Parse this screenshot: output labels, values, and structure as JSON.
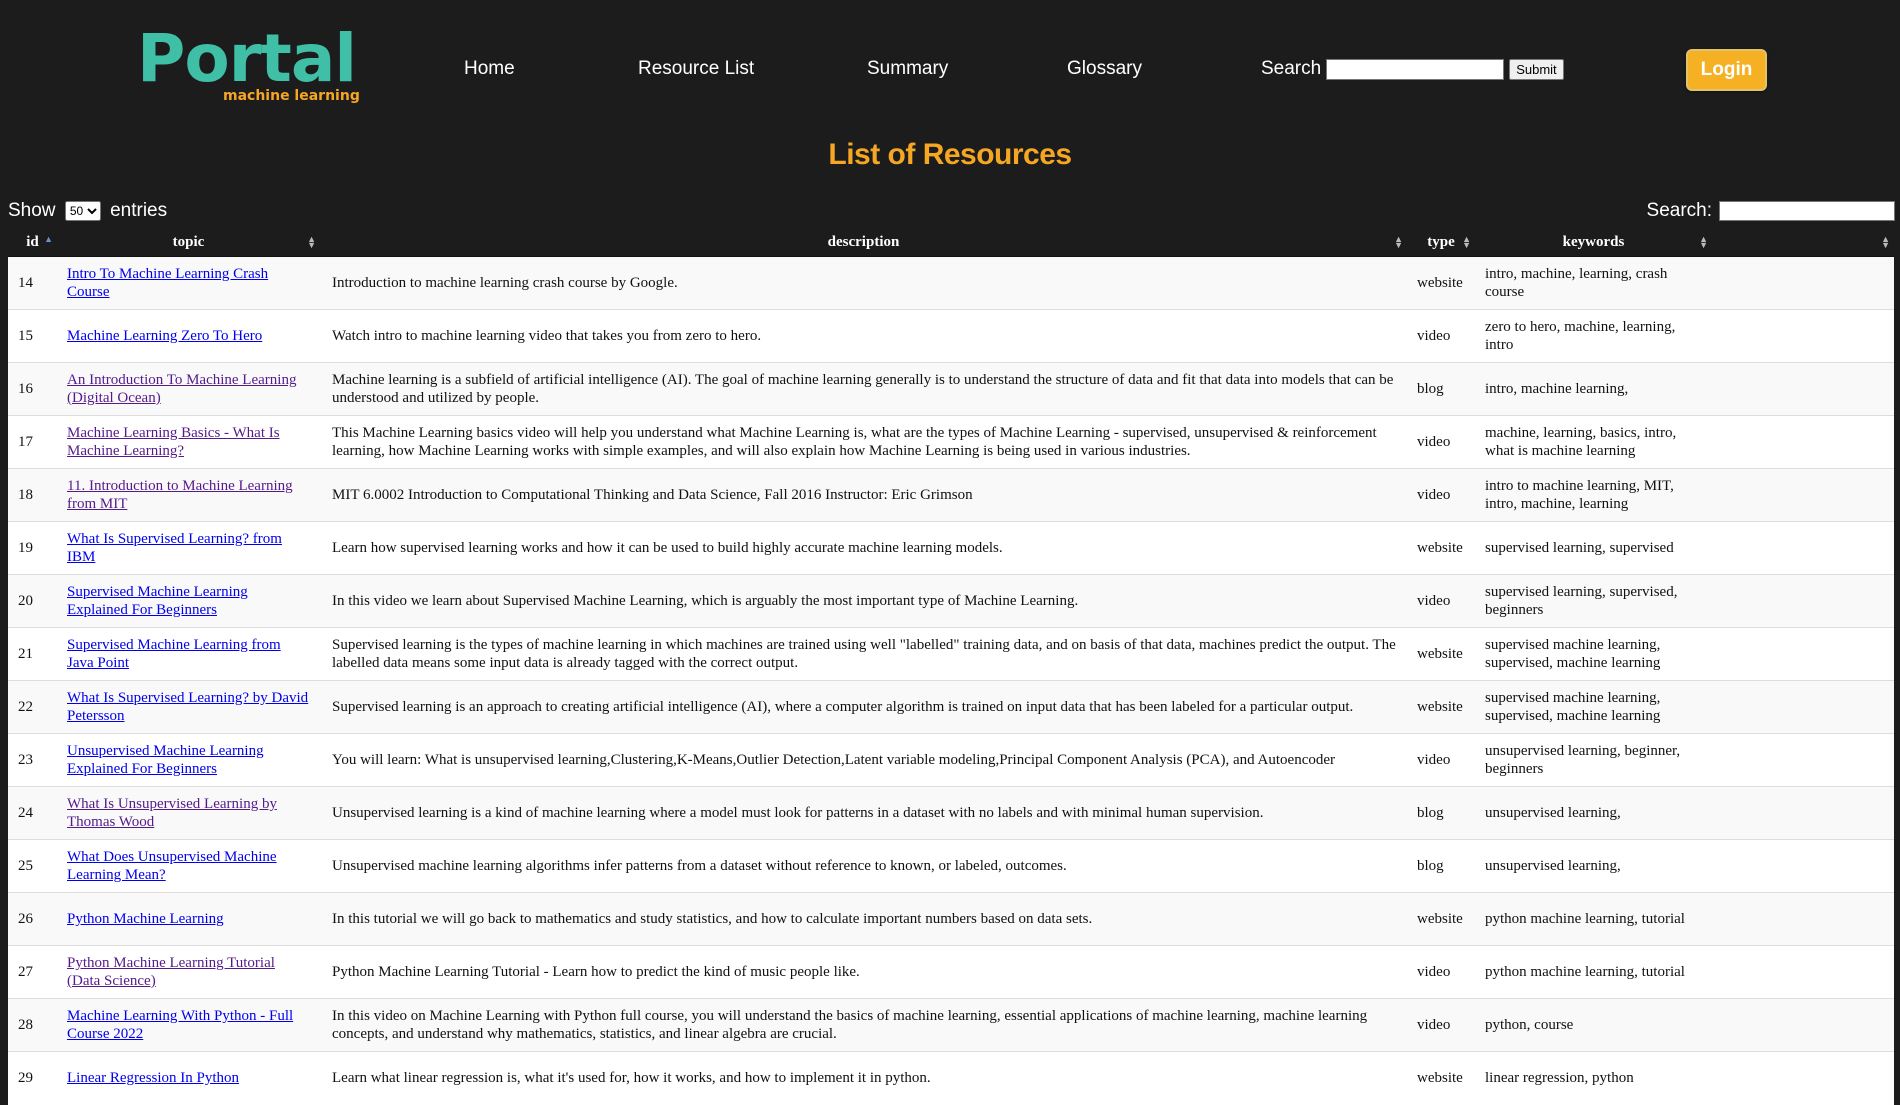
{
  "header": {
    "logo_main": "Portal",
    "logo_sub": "machine learning",
    "nav": [
      "Home",
      "Resource List",
      "Summary",
      "Glossary"
    ],
    "search_label": "Search",
    "search_value": "",
    "submit_label": "Submit",
    "login_label": "Login"
  },
  "page_title": "List of Resources",
  "controls": {
    "show_label": "Show",
    "entries_value": "50",
    "entries_label": "entries",
    "filter_label": "Search:"
  },
  "table": {
    "columns": [
      "id",
      "topic",
      "description",
      "type",
      "keywords",
      ""
    ],
    "rows": [
      {
        "id": "14",
        "topic": "Intro To Machine Learning Crash Course",
        "description": "Introduction to machine learning crash course by Google.",
        "type": "website",
        "keywords": "intro, machine, learning, crash course"
      },
      {
        "id": "15",
        "topic": "Machine Learning Zero To Hero",
        "description": "Watch intro to machine learning video that takes you from zero to hero.",
        "type": "video",
        "keywords": "zero to hero, machine, learning, intro"
      },
      {
        "id": "16",
        "topic": "An Introduction To Machine Learning (Digital Ocean)",
        "description": "Machine learning is a subfield of artificial intelligence (AI). The goal of machine learning generally is to understand the structure of data and fit that data into models that can be understood and utilized by people.",
        "type": "blog",
        "keywords": "intro, machine learning,"
      },
      {
        "id": "17",
        "topic": "Machine Learning Basics - What Is Machine Learning?",
        "description": "This Machine Learning basics video will help you understand what Machine Learning is, what are the types of Machine Learning - supervised, unsupervised & reinforcement learning, how Machine Learning works with simple examples, and will also explain how Machine Learning is being used in various industries.",
        "type": "video",
        "keywords": "machine, learning, basics, intro, what is machine learning"
      },
      {
        "id": "18",
        "topic": "11. Introduction to Machine Learning from MIT",
        "description": "MIT 6.0002 Introduction to Computational Thinking and Data Science, Fall 2016 Instructor: Eric Grimson",
        "type": "video",
        "keywords": "intro to machine learning, MIT, intro, machine, learning"
      },
      {
        "id": "19",
        "topic": "What Is Supervised Learning? from IBM",
        "description": "Learn how supervised learning works and how it can be used to build highly accurate machine learning models.",
        "type": "website",
        "keywords": "supervised learning, supervised"
      },
      {
        "id": "20",
        "topic": "Supervised Machine Learning Explained For Beginners",
        "description": "In this video we learn about Supervised Machine Learning, which is arguably the most important type of Machine Learning.",
        "type": "video",
        "keywords": "supervised learning, supervised, beginners"
      },
      {
        "id": "21",
        "topic": "Supervised Machine Learning from Java Point",
        "description": "Supervised learning is the types of machine learning in which machines are trained using well \"labelled\" training data, and on basis of that data, machines predict the output. The labelled data means some input data is already tagged with the correct output.",
        "type": "website",
        "keywords": "supervised machine learning, supervised, machine learning"
      },
      {
        "id": "22",
        "topic": "What Is Supervised Learning? by David Petersson",
        "description": "Supervised learning is an approach to creating artificial intelligence (AI), where a computer algorithm is trained on input data that has been labeled for a particular output.",
        "type": "website",
        "keywords": "supervised machine learning, supervised, machine learning"
      },
      {
        "id": "23",
        "topic": "Unsupervised Machine Learning Explained For Beginners",
        "description": "You will learn: What is unsupervised learning,Clustering,K-Means,Outlier Detection,Latent variable modeling,Principal Component Analysis (PCA), and Autoencoder",
        "type": "video",
        "keywords": "unsupervised learning, beginner, beginners"
      },
      {
        "id": "24",
        "topic": "What Is Unsupervised Learning by Thomas Wood",
        "description": "Unsupervised learning is a kind of machine learning where a model must look for patterns in a dataset with no labels and with minimal human supervision.",
        "type": "blog",
        "keywords": "unsupervised learning,"
      },
      {
        "id": "25",
        "topic": "What Does Unsupervised Machine Learning Mean?",
        "description": "Unsupervised machine learning algorithms infer patterns from a dataset without reference to known, or labeled, outcomes.",
        "type": "blog",
        "keywords": "unsupervised learning,"
      },
      {
        "id": "26",
        "topic": "Python Machine Learning",
        "description": "In this tutorial we will go back to mathematics and study statistics, and how to calculate important numbers based on data sets.",
        "type": "website",
        "keywords": "python machine learning, tutorial"
      },
      {
        "id": "27",
        "topic": "Python Machine Learning Tutorial (Data Science)",
        "description": "Python Machine Learning Tutorial - Learn how to predict the kind of music people like.",
        "type": "video",
        "keywords": "python machine learning, tutorial"
      },
      {
        "id": "28",
        "topic": "Machine Learning With Python - Full Course 2022",
        "description": "In this video on Machine Learning with Python full course, you will understand the basics of machine learning, essential applications of machine learning, machine learning concepts, and understand why mathematics, statistics, and linear algebra are crucial.",
        "type": "video",
        "keywords": "python, course"
      },
      {
        "id": "29",
        "topic": "Linear Regression In Python",
        "description": "Learn what linear regression is, what it's used for, how it works, and how to implement it in python.",
        "type": "website",
        "keywords": "linear regression, python"
      }
    ]
  },
  "colors": {
    "background": "#1c1c1d",
    "logo": "#3fbfa6",
    "accent": "#f5a623",
    "login": "#f5b024",
    "link": "#0000ee",
    "visited_link": "#551a8b"
  }
}
